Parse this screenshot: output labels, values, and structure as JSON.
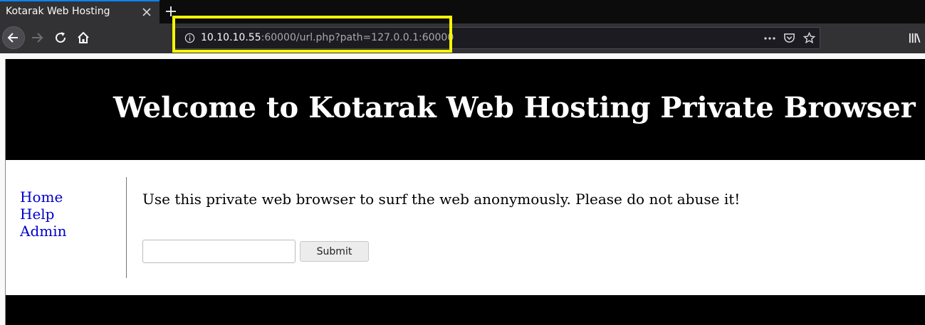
{
  "browser": {
    "tab_title": "Kotarak Web Hosting",
    "url_host": "10.10.10.55",
    "url_rest": ":60000/url.php?path=127.0.0.1:60000",
    "accent_color": "#0a84ff",
    "highlight_color": "#f7f500"
  },
  "page": {
    "title": "Welcome to Kotarak Web Hosting Private Browser",
    "nav": [
      "Home",
      "Help",
      "Admin"
    ],
    "intro": "Use this private web browser to surf the web anonymously. Please do not abuse it!",
    "input_value": "",
    "submit_label": "Submit",
    "link_color": "#0000cc"
  }
}
